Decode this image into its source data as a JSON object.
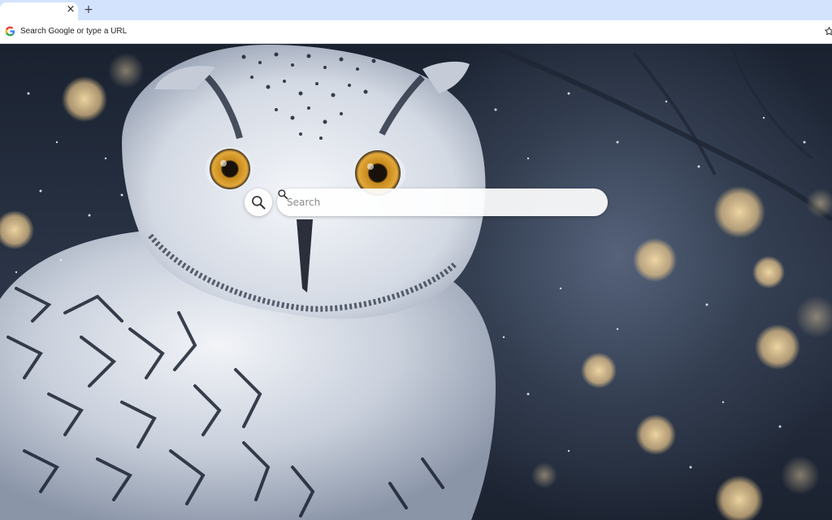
{
  "browser": {
    "tab": {
      "title": "",
      "close_glyph": "×"
    },
    "new_tab_glyph": "+",
    "omnibox": {
      "text": "Search Google or type a URL",
      "left_icon": "google-g-icon",
      "right_icon": "bookmark-star-icon"
    }
  },
  "page": {
    "background": "snowy owl photo with bokeh lights",
    "search": {
      "placeholder": "Search",
      "left_icon": "magnifier-icon",
      "right_icon": "search-icon"
    }
  },
  "colors": {
    "tabstrip": "#d3e3fd",
    "toolbar": "#ffffff",
    "search_bar": "#ffffff"
  }
}
